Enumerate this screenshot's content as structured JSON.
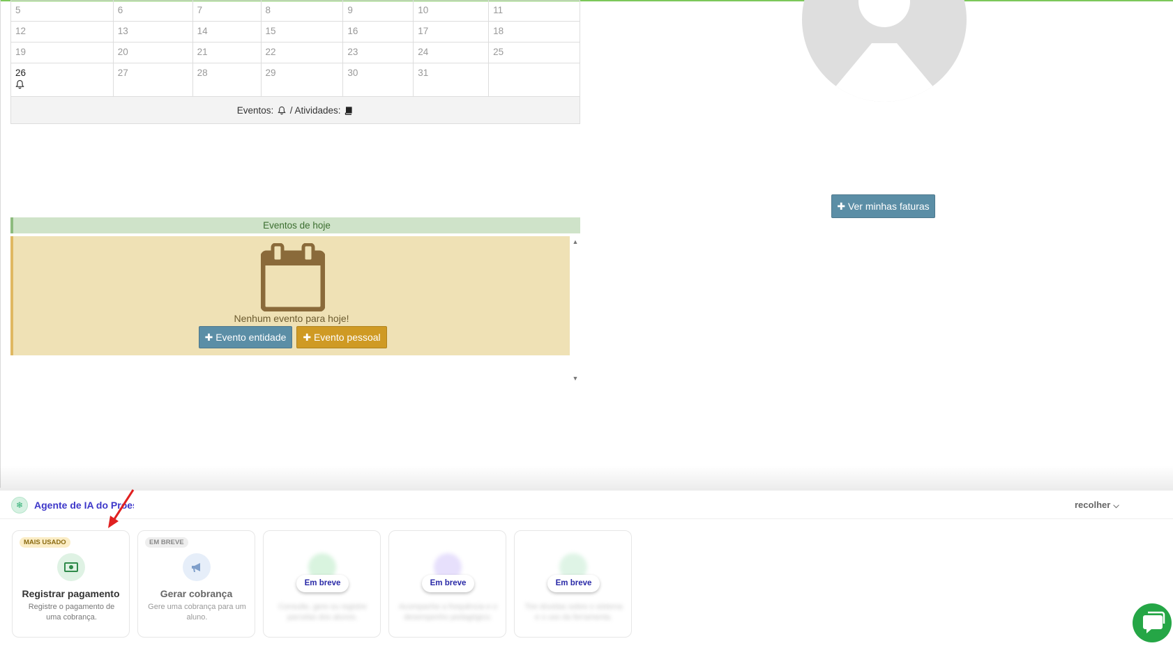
{
  "calendar": {
    "rows": [
      [
        "5",
        "6",
        "7",
        "8",
        "9",
        "10",
        "11"
      ],
      [
        "12",
        "13",
        "14",
        "15",
        "16",
        "17",
        "18"
      ],
      [
        "19",
        "20",
        "21",
        "22",
        "23",
        "24",
        "25"
      ],
      [
        "26",
        "27",
        "28",
        "29",
        "30",
        "31",
        ""
      ]
    ],
    "legend_events": "Eventos:",
    "legend_activities": "/ Atividades:"
  },
  "today_events": {
    "header": "Eventos de hoje",
    "empty_message": "Nenhum evento para hoje!",
    "entity_button": "Evento entidade",
    "personal_button": "Evento pessoal"
  },
  "right_panel": {
    "invoices_button": "Ver minhas faturas"
  },
  "ai_agent": {
    "title": "Agente de IA do Proesc",
    "collapse_label": "recolher",
    "cards": [
      {
        "badge": "MAIS USADO",
        "title": "Registrar pagamento",
        "description": "Registre o pagamento de uma cobrança.",
        "icon": "money-icon"
      },
      {
        "badge": "EM BREVE",
        "title": "Gerar cobrança",
        "description": "Gere uma cobrança para um aluno.",
        "icon": "megaphone-icon"
      },
      {
        "soon_label": "Em breve",
        "description": "Consulte, gere ou registre parcelas dos alunos.",
        "icon": "blurred-icon"
      },
      {
        "soon_label": "Em breve",
        "description": "Acompanhe a frequência e o desempenho pedagógico.",
        "icon": "blurred-icon"
      },
      {
        "soon_label": "Em breve",
        "description": "Tire dúvidas sobre o sistema e o uso da ferramenta.",
        "icon": "blurred-icon"
      }
    ]
  },
  "colors": {
    "accent_teal": "#5b8ea6",
    "accent_gold": "#cf9a24",
    "ai_title": "#3d37c9",
    "chat_green": "#25a646"
  }
}
